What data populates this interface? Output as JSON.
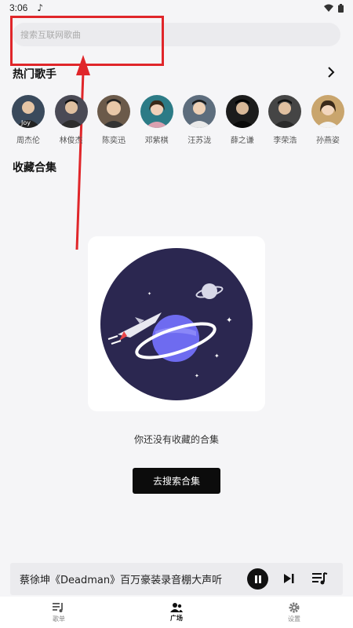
{
  "status_bar": {
    "time": "3:06",
    "music_icon": "music-note-icon",
    "wifi_icon": "wifi-icon",
    "battery_icon": "battery-icon"
  },
  "search": {
    "placeholder": "搜索互联网歌曲"
  },
  "hot_singers": {
    "title": "热门歌手",
    "more_icon": "chevron-right-icon",
    "items": [
      {
        "name": "周杰伦",
        "color": "#3a4a5c"
      },
      {
        "name": "林俊杰",
        "color": "#4a4a55"
      },
      {
        "name": "陈奕迅",
        "color": "#6b5a4a"
      },
      {
        "name": "邓紫棋",
        "color": "#2c7b86"
      },
      {
        "name": "汪苏泷",
        "color": "#5d6d7d"
      },
      {
        "name": "薛之谦",
        "color": "#1c1c1c"
      },
      {
        "name": "李荣浩",
        "color": "#454545"
      },
      {
        "name": "孙燕姿",
        "color": "#c9a56d"
      }
    ]
  },
  "favorites": {
    "title": "收藏合集"
  },
  "empty_state": {
    "message": "你还没有收藏的合集",
    "button_label": "去搜索合集",
    "illustration_colors": {
      "planet_bg": "#2b2750",
      "planet": "#6e6bf0",
      "ring": "#ffffff"
    }
  },
  "mini_player": {
    "track": "蔡徐坤《Deadman》百万豪装录音棚大声听",
    "pause_icon": "pause-icon",
    "next_icon": "skip-next-icon",
    "queue_icon": "playlist-icon"
  },
  "bottom_nav": {
    "items": [
      {
        "label": "歌单",
        "icon": "playlist-icon",
        "active": false
      },
      {
        "label": "广场",
        "icon": "people-icon",
        "active": true
      },
      {
        "label": "设置",
        "icon": "gear-icon",
        "active": false
      }
    ]
  },
  "colors": {
    "accent": "#0c0c0c",
    "annotation": "#e0262a",
    "background": "#f5f5f7"
  }
}
